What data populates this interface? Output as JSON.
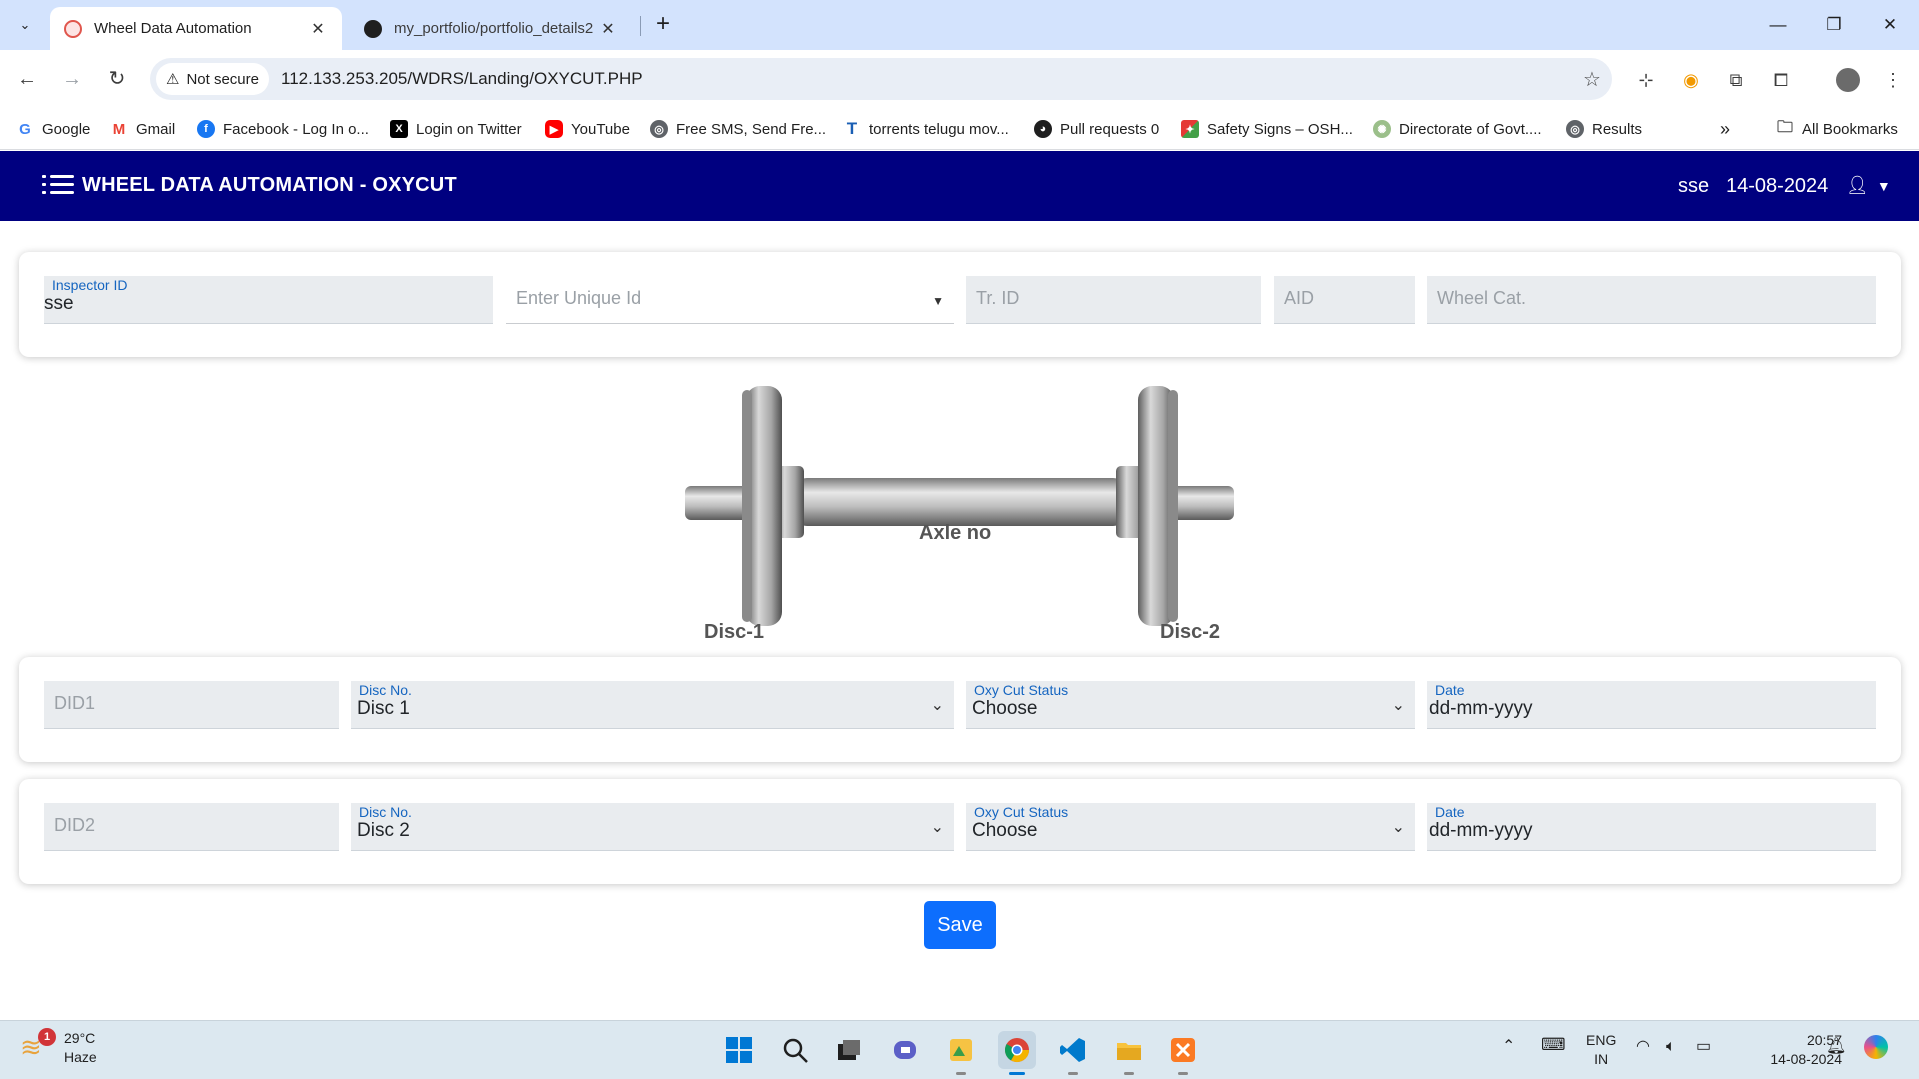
{
  "browser": {
    "tabs": [
      {
        "title": "Wheel Data Automation",
        "active": true
      },
      {
        "title": "my_portfolio/portfolio_details2",
        "active": false
      }
    ],
    "security_label": "Not secure",
    "url": "112.133.253.205/WDRS/Landing/OXYCUT.PHP",
    "bookmarks": [
      {
        "label": "Google",
        "icon": "google-icon"
      },
      {
        "label": "Gmail",
        "icon": "gmail-icon"
      },
      {
        "label": "Facebook - Log In o...",
        "icon": "facebook-icon"
      },
      {
        "label": "Login on Twitter",
        "icon": "x-icon"
      },
      {
        "label": "YouTube",
        "icon": "youtube-icon"
      },
      {
        "label": "Free SMS, Send Fre...",
        "icon": "globe-icon"
      },
      {
        "label": "torrents telugu mov...",
        "icon": "t-icon"
      },
      {
        "label": "Pull requests 0",
        "icon": "github-icon"
      },
      {
        "label": "Safety Signs – OSH...",
        "icon": "safety-icon"
      },
      {
        "label": "Directorate of Govt....",
        "icon": "emblem-icon"
      },
      {
        "label": "Results",
        "icon": "globe-icon"
      }
    ],
    "all_bookmarks": "All Bookmarks",
    "overflow": "»"
  },
  "app": {
    "title": "WHEEL DATA AUTOMATION - OXYCUT",
    "user": "sse",
    "date": "14-08-2024",
    "accent": "#000080"
  },
  "top_form": {
    "inspector_label": "Inspector ID",
    "inspector_value": "sse",
    "unique_id_placeholder": "Enter Unique Id",
    "tr_id_placeholder": "Tr. ID",
    "aid_placeholder": "AID",
    "wheel_cat_placeholder": "Wheel Cat."
  },
  "diagram": {
    "axle_label": "Axle no",
    "disc1_label": "Disc-1",
    "disc2_label": "Disc-2"
  },
  "disc_rows": [
    {
      "did_placeholder": "DID1",
      "disc_no_label": "Disc No.",
      "disc_no_value": "Disc 1",
      "status_label": "Oxy Cut Status",
      "status_value": "Choose",
      "date_label": "Date",
      "date_value": "dd-mm-yyyy"
    },
    {
      "did_placeholder": "DID2",
      "disc_no_label": "Disc No.",
      "disc_no_value": "Disc 2",
      "status_label": "Oxy Cut Status",
      "status_value": "Choose",
      "date_label": "Date",
      "date_value": "dd-mm-yyyy"
    }
  ],
  "save_label": "Save",
  "taskbar": {
    "weather_temp": "29°C",
    "weather_desc": "Haze",
    "weather_badge": "1",
    "lang_1": "ENG",
    "lang_2": "IN",
    "time": "20:57",
    "date": "14-08-2024"
  }
}
